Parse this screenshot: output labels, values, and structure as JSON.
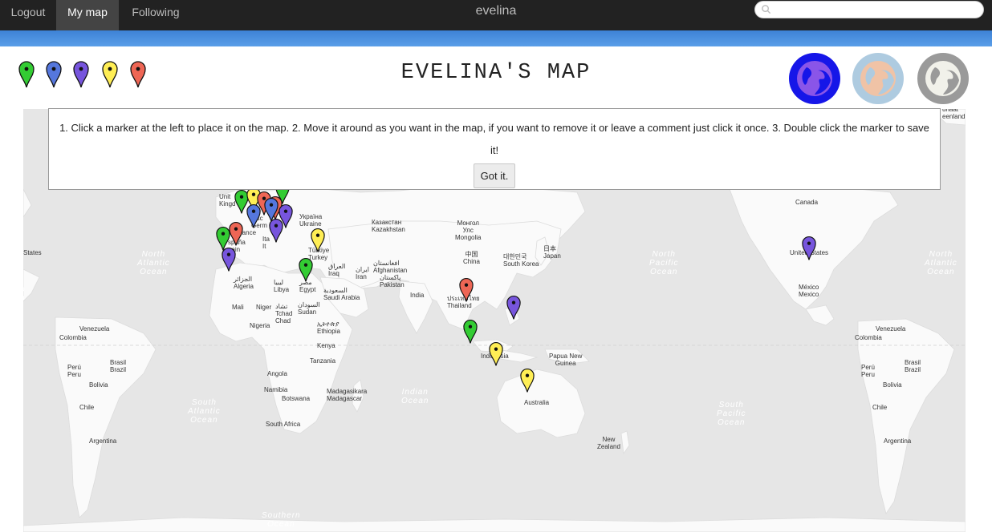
{
  "nav": {
    "logout": "Logout",
    "my_map": "My map",
    "following": "Following",
    "brand": "evelina",
    "search_placeholder": ""
  },
  "header": {
    "title": "EVELINA'S MAP",
    "marker_buttons": [
      "green",
      "blue",
      "purple",
      "yellow",
      "red"
    ],
    "globe_buttons": [
      "globe-blue-icon",
      "globe-peach-icon",
      "globe-gray-icon"
    ]
  },
  "colors": {
    "green": "#33cc33",
    "blue": "#5577dd",
    "purple": "#7755dd",
    "yellow": "#ffee55",
    "red": "#ee6655",
    "accent_bar": "#4a90e2"
  },
  "instructions": {
    "text": "1. Click a marker at the left to place it on the map. 2. Move it around as you want in the map, if you want to remove it or leave a comment just click it once. 3. Double click the marker to save it!",
    "button": "Got it."
  },
  "map": {
    "labels": {
      "states_left": "States",
      "canada": "Canada",
      "united_states": "United States",
      "mexico": "México\nMexico",
      "venezuela_l": "Venezuela",
      "colombia_l": "Colombia",
      "brasil_l": "Brasil\nBrazil",
      "peru_l": "Perú\nPeru",
      "bolivia_l": "Bolivia",
      "chile_l": "Chile",
      "argentina_l": "Argentina",
      "venezuela_r": "Venezuela",
      "colombia_r": "Colombia",
      "brasil_r": "Brasil\nBrazil",
      "peru_r": "Perú\nPeru",
      "bolivia_r": "Bolivia",
      "chile_r": "Chile",
      "argentina_r": "Argentina",
      "united_kingdom": "Unit\nKingd",
      "germany": "utsc\nGerm",
      "france": "rance",
      "spain": "spaña\npain",
      "italy": "Ita\nIt",
      "ukraine": "Україна\nUkraine",
      "kazakhstan": "Казакстан\nKazakhstan",
      "mongolia": "Монгол\nУлс\nMongolia",
      "china": "中国\nChina",
      "japan": "日本\nJapan",
      "south_korea": "대한민국\nSouth Korea",
      "turkey": "Türkiye\nTurkey",
      "iraq": "العراق\nIraq",
      "iran": "ایران\nIran",
      "afghanistan": "افغانستان\nAfghanistan",
      "pakistan": "پاکستان\nPakistan",
      "india": "India",
      "thailand": "ประเทศไทย\nThailand",
      "algeria": "الجزائر\nAlgeria",
      "libya": "ليبيا\nLibya",
      "egypt": "مصر\nEgypt",
      "saudi_arabia": "السعودية\nSaudi Arabia",
      "mali": "Mali",
      "niger": "Niger",
      "chad": "تشاد\nTchad\nChad",
      "sudan": "السودان\nSudan",
      "nigeria": "Nigeria",
      "ethiopia": "ኢትዮጵያ\nEthiopia",
      "kenya": "Kenya",
      "tanzania": "Tanzania",
      "angola": "Angola",
      "namibia": "Namibia",
      "botswana": "Botswana",
      "madagascar": "Madagasikara\nMadagascar",
      "south_africa": "South Africa",
      "indonesia": "Indonesia",
      "papua": "Papua New\nGuinea",
      "australia": "Australia",
      "new_zealand": "New\nZealand",
      "greenland": "unaat\neenland"
    },
    "oceans": {
      "north_atlantic": "North\nAtlantic\nOcean",
      "south_atlantic": "South\nAtlantic\nOcean",
      "indian": "Indian\nOcean",
      "north_pacific": "North\nPacific\nOcean",
      "south_pacific": "South\nPacific\nOcean",
      "southern": "Southern\nOcean",
      "north_atlantic_r": "North\nAtlantic\nOcean",
      "left_edge": "o\nn"
    },
    "markers": [
      "green",
      "yellow",
      "red",
      "green",
      "red",
      "blue",
      "purple",
      "purple",
      "blue",
      "red",
      "green",
      "purple",
      "yellow",
      "green",
      "red",
      "purple",
      "green",
      "yellow",
      "yellow",
      "purple"
    ]
  }
}
